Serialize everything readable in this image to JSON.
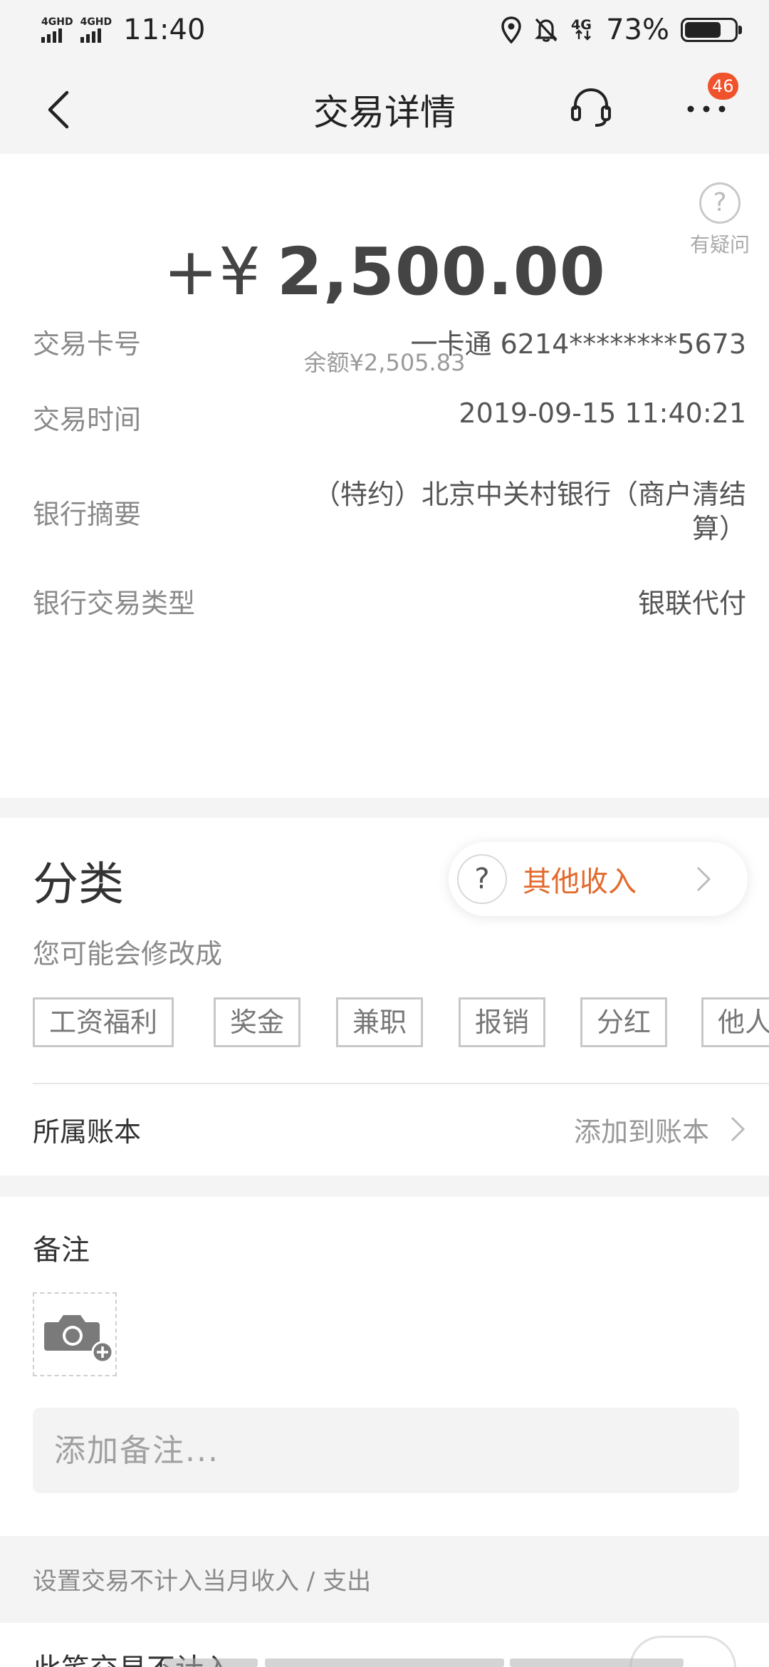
{
  "status_bar": {
    "signal_1": "4GHD",
    "signal_2": "4GHD",
    "time": "11:40",
    "network": "4G",
    "battery": "73%",
    "battery_level": 0.73,
    "icons": [
      "location-icon",
      "bell-muted-icon",
      "4g-icon",
      "battery-icon"
    ]
  },
  "header": {
    "title": "交易详情",
    "badge_count": "46",
    "icons": [
      "back-chevron-icon",
      "headset-icon",
      "more-dots-icon"
    ]
  },
  "transaction": {
    "help_label": "有疑问",
    "amount_prefix": "+¥",
    "amount": "2,500.00",
    "balance": "余额¥2,505.83",
    "details": [
      {
        "label": "交易卡号",
        "value": "一卡通 6214********5673"
      },
      {
        "label": "交易时间",
        "value": "2019-09-15 11:40:21"
      },
      {
        "label": "银行摘要",
        "value_line1": "（特约）北京中关村银行（商户清结",
        "value_line2": "算）"
      },
      {
        "label": "银行交易类型",
        "value": "银联代付"
      }
    ]
  },
  "category": {
    "title": "分类",
    "selected": "其他收入",
    "question_mark": "?",
    "hint": "您可能会修改成",
    "suggestions": [
      "工资福利",
      "奖金",
      "兼职",
      "报销",
      "分红",
      "他人转账"
    ],
    "book_label": "所属账本",
    "book_action": "添加到账本"
  },
  "note": {
    "label": "备注",
    "placeholder": "添加备注..."
  },
  "exclude": {
    "header": "设置交易不计入当月收入 / 支出",
    "label": "此笔交易不计入",
    "toggle_on": false
  },
  "colors": {
    "accent": "#e36a2c",
    "badge": "#f0522b",
    "background": "#f4f4f4"
  }
}
